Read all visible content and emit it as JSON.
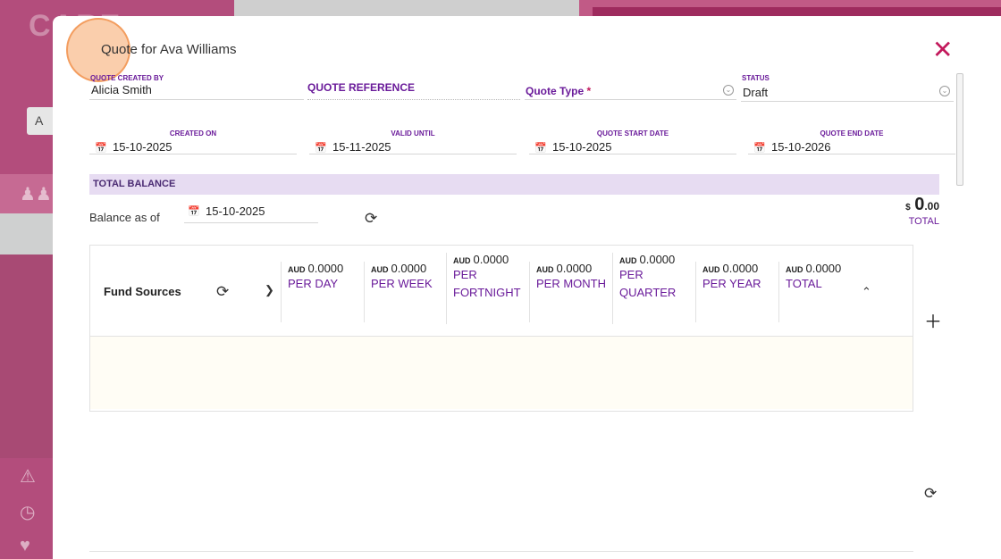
{
  "background": {
    "logo": "CARE",
    "search_letter": "A"
  },
  "modal": {
    "title": "Quote for Ava Williams",
    "fields": {
      "created_by_label": "QUOTE CREATED BY",
      "created_by_value": "Alicia Smith",
      "reference_label": "QUOTE REFERENCE",
      "quote_type_label": "Quote Type",
      "required_mark": "*",
      "status_label": "STATUS",
      "status_value": "Draft"
    },
    "dates": [
      {
        "label": "CREATED ON",
        "value": "15-10-2025"
      },
      {
        "label": "VALID UNTIL",
        "value": "15-11-2025"
      },
      {
        "label": "QUOTE START DATE",
        "value": "15-10-2025"
      },
      {
        "label": "QUOTE END DATE",
        "value": "15-10-2026"
      }
    ],
    "balance": {
      "header": "TOTAL BALANCE",
      "as_of_label": "Balance as of",
      "as_of_date": "15-10-2025",
      "currency": "$",
      "amount_int": "0",
      "amount_dec": ".00",
      "total_label": "TOTAL"
    },
    "fund_sources": {
      "title": "Fund Sources",
      "columns": [
        {
          "currency": "AUD",
          "amount": "0.0000",
          "label": "PER DAY"
        },
        {
          "currency": "AUD",
          "amount": "0.0000",
          "label": "PER WEEK"
        },
        {
          "currency": "AUD",
          "amount": "0.0000",
          "label": "PER FORTNIGHT"
        },
        {
          "currency": "AUD",
          "amount": "0.0000",
          "label": "PER MONTH"
        },
        {
          "currency": "AUD",
          "amount": "0.0000",
          "label": "PER QUARTER"
        },
        {
          "currency": "AUD",
          "amount": "0.0000",
          "label": "PER YEAR"
        },
        {
          "currency": "AUD",
          "amount": "0.0000",
          "label": "TOTAL"
        }
      ]
    },
    "icons": {
      "close": "close-icon",
      "refresh": "refresh-icon",
      "calendar": "calendar-icon",
      "add": "plus-icon"
    }
  }
}
